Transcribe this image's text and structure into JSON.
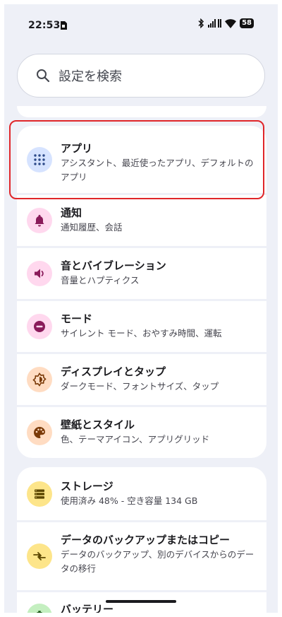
{
  "status": {
    "time": "22:53",
    "battery": "58"
  },
  "search": {
    "placeholder": "設定を検索"
  },
  "group1": [
    {
      "title": "アプリ",
      "subtitle": "アシスタント、最近使ったアプリ、デフォルトのアプリ",
      "icon": "apps-grid-icon",
      "color": "#d6e3ff"
    },
    {
      "title": "通知",
      "subtitle": "通知履歴、会話",
      "icon": "bell-icon",
      "color": "#ffd8ee"
    },
    {
      "title": "音とバイブレーション",
      "subtitle": "音量とハプティクス",
      "icon": "volume-icon",
      "color": "#ffd8ee"
    },
    {
      "title": "モード",
      "subtitle": "サイレント モード、おやすみ時間、運転",
      "icon": "minus-circle-icon",
      "color": "#ffd8ee"
    },
    {
      "title": "ディスプレイとタップ",
      "subtitle": "ダークモード、フォントサイズ、タップ",
      "icon": "brightness-icon",
      "color": "#ffdcc2"
    },
    {
      "title": "壁紙とスタイル",
      "subtitle": "色、テーマアイコン、アプリグリッド",
      "icon": "palette-icon",
      "color": "#ffdcc2"
    }
  ],
  "group2": [
    {
      "title": "ストレージ",
      "subtitle": "使用済み 48% - 空き容量 134 GB",
      "icon": "storage-icon",
      "color": "#fde58a"
    },
    {
      "title": "データのバックアップまたはコピー",
      "subtitle": "データのバックアップ、別のデバイスからのデータの移行",
      "icon": "transfer-icon",
      "color": "#fde58a"
    },
    {
      "title": "バッテリー",
      "subtitle": "",
      "icon": "battery-icon",
      "color": "#c4efc0"
    }
  ]
}
